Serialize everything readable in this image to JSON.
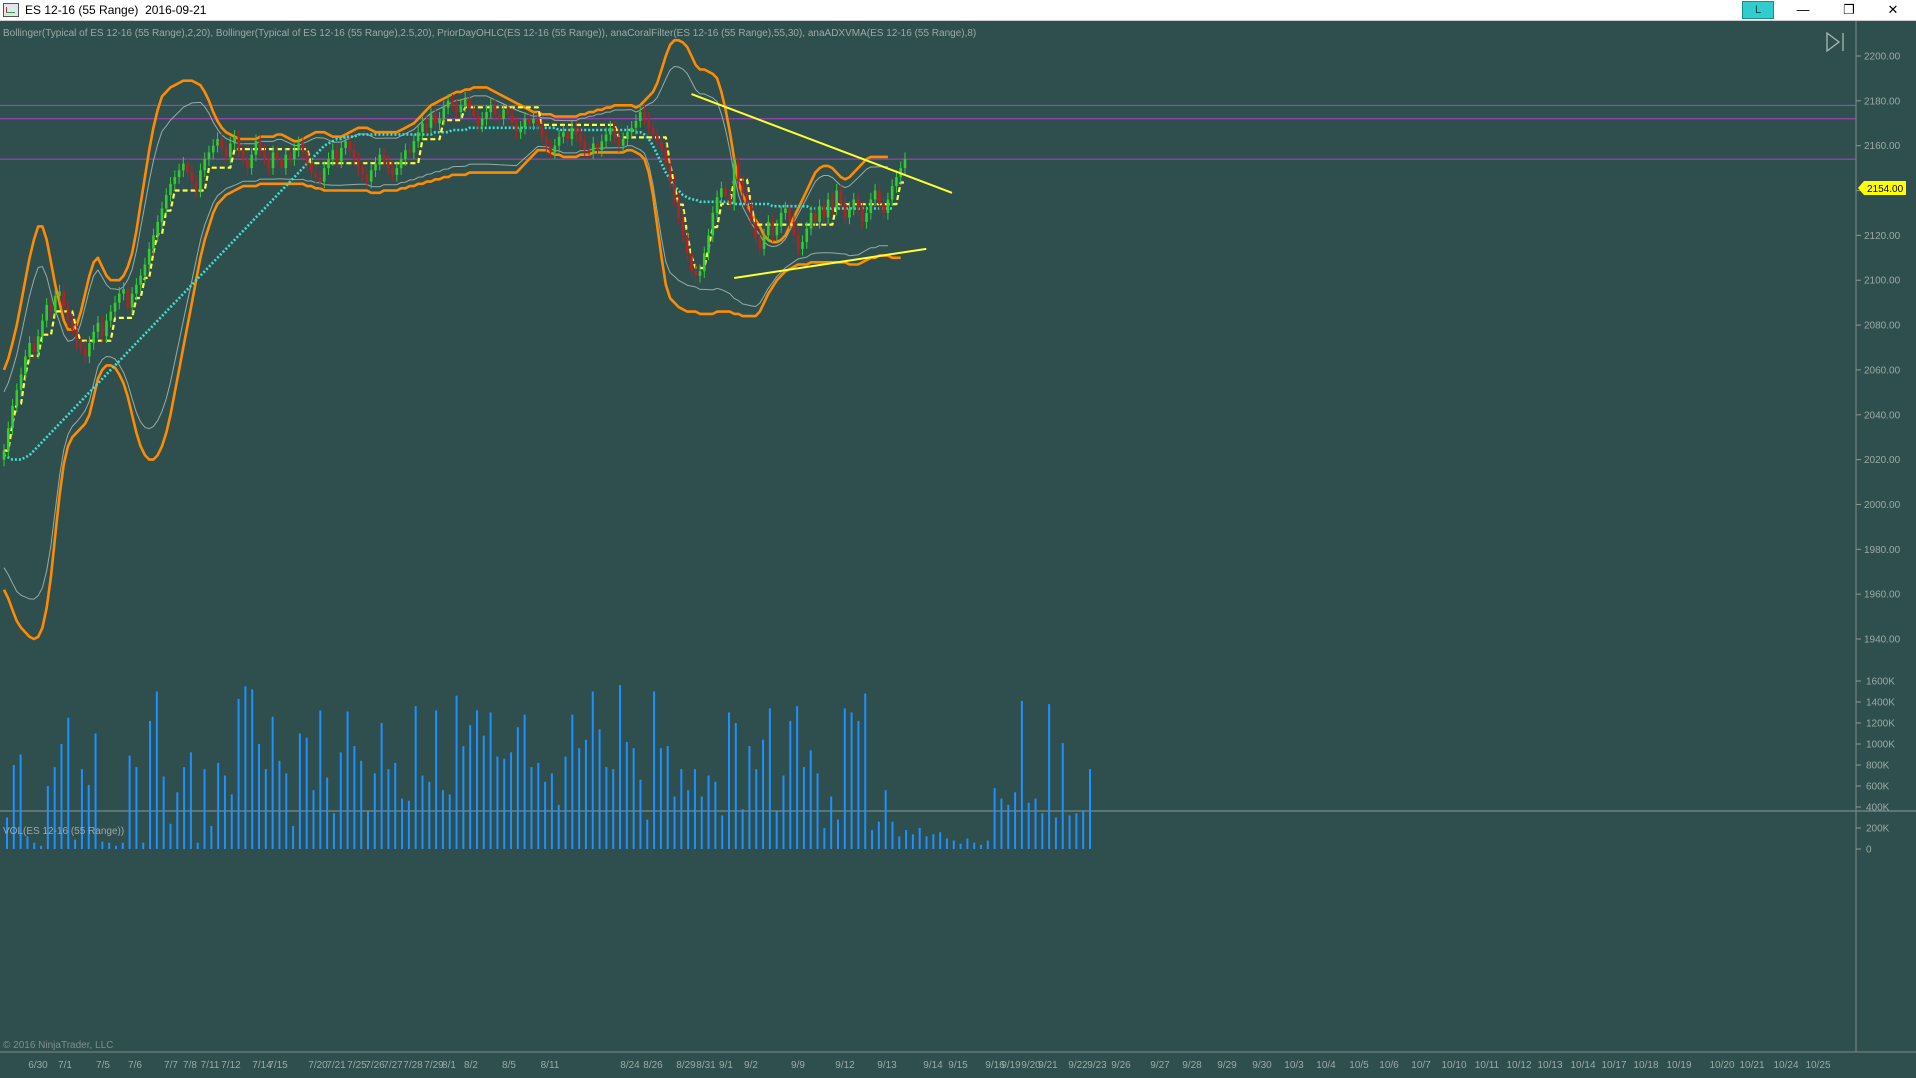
{
  "window": {
    "title": "ES 12-16 (55 Range)  2016-09-21",
    "link_label": "L",
    "minimize_glyph": "—",
    "restore_glyph": "❐",
    "close_glyph": "✕"
  },
  "price_panel": {
    "indicator_label": "Bollinger(Typical of ES 12-16 (55 Range),2,20), Bollinger(Typical of ES 12-16 (55 Range),2.5,20), PriorDayOHLC(ES 12-16 (55 Range)), anaCoralFilter(ES 12-16 (55 Range),55,30), anaADXVMA(ES 12-16 (55 Range),8)",
    "last_price_label": "2154.00"
  },
  "volume_panel": {
    "indicator_label": "VOL(ES 12-16 (55 Range))"
  },
  "copyright": "© 2016 NinjaTrader, LLC",
  "colors": {
    "background": "#2f4f4f",
    "up_candle": "#32cd32",
    "down_candle": "#b22222",
    "bollinger_outer": "#ff8c00",
    "bollinger_inner": "#9aaaa5",
    "coral_filter": "#40e0d0",
    "adxvma": "#ffff40",
    "trendline": "#ffff33",
    "prior_day_lines": "#b040c8",
    "volume": "#1e90ff",
    "last_price_tag": "#ffff00"
  },
  "chart_data": [
    {
      "type": "candlestick",
      "y_ticks": [
        2200,
        2180,
        2160,
        2140,
        2120,
        2100,
        2080,
        2060,
        2040,
        2020,
        2000,
        1980,
        1960,
        1940
      ],
      "ylim": [
        1930,
        2210
      ],
      "x_labels": [
        "6/30",
        "7/1",
        "7/5",
        "7/6",
        "7/7",
        "7/8",
        "7/11",
        "7/12",
        "7/14",
        "7/15",
        "7/20",
        "7/21",
        "7/25",
        "7/26",
        "7/27",
        "7/28",
        "7/29",
        "8/1",
        "8/2",
        "8/5",
        "8/11",
        "8/24",
        "8/26",
        "8/29",
        "8/31",
        "9/1",
        "9/2",
        "9/9",
        "9/12",
        "9/13",
        "9/14",
        "9/15",
        "9/16",
        "9/19",
        "9/20",
        "9/21",
        "9/22",
        "9/23",
        "9/26",
        "9/27",
        "9/28",
        "9/29",
        "9/30",
        "10/3",
        "10/4",
        "10/5",
        "10/6",
        "10/7",
        "10/10",
        "10/11",
        "10/12",
        "10/13",
        "10/14",
        "10/17",
        "10/18",
        "10/19",
        "10/20",
        "10/21",
        "10/24",
        "10/25"
      ],
      "last_price": 2154,
      "prior_day_levels": [
        2178,
        2172,
        2154
      ],
      "trendlines": [
        {
          "from": [
            161,
            2183
          ],
          "to": [
            222,
            2139
          ]
        },
        {
          "from": [
            171,
            2101
          ],
          "to": [
            216,
            2114
          ]
        }
      ],
      "close": [
        2024,
        2034,
        2044,
        2051,
        2058,
        2066,
        2072,
        2068,
        2075,
        2082,
        2089,
        2086,
        2093,
        2095,
        2088,
        2082,
        2078,
        2072,
        2070,
        2066,
        2072,
        2077,
        2081,
        2075,
        2082,
        2086,
        2090,
        2094,
        2096,
        2088,
        2094,
        2098,
        2102,
        2107,
        2114,
        2120,
        2126,
        2132,
        2138,
        2143,
        2146,
        2149,
        2152,
        2148,
        2144,
        2140,
        2149,
        2154,
        2157,
        2160,
        2163,
        2159,
        2155,
        2161,
        2164,
        2158,
        2154,
        2150,
        2156,
        2162,
        2158,
        2154,
        2150,
        2157,
        2154,
        2150,
        2156,
        2154,
        2158,
        2161,
        2157,
        2152,
        2148,
        2146,
        2144,
        2150,
        2154,
        2158,
        2153,
        2159,
        2162,
        2158,
        2154,
        2150,
        2147,
        2144,
        2149,
        2152,
        2156,
        2153,
        2150,
        2147,
        2150,
        2154,
        2158,
        2157,
        2162,
        2166,
        2170,
        2168,
        2174,
        2170,
        2172,
        2177,
        2180,
        2178,
        2175,
        2178,
        2181,
        2176,
        2173,
        2169,
        2172,
        2175,
        2178,
        2174,
        2172,
        2176,
        2174,
        2170,
        2166,
        2168,
        2172,
        2170,
        2172,
        2169,
        2164,
        2160,
        2157,
        2160,
        2164,
        2166,
        2163,
        2168,
        2165,
        2162,
        2158,
        2157,
        2161,
        2158,
        2162,
        2165,
        2168,
        2164,
        2160,
        2163,
        2166,
        2168,
        2171,
        2175,
        2172,
        2168,
        2165,
        2162,
        2158,
        2152,
        2144,
        2136,
        2128,
        2120,
        2112,
        2104,
        2102,
        2104,
        2112,
        2120,
        2130,
        2137,
        2141,
        2138,
        2134,
        2152,
        2144,
        2139,
        2134,
        2126,
        2119,
        2114,
        2120,
        2126,
        2120,
        2124,
        2130,
        2132,
        2126,
        2120,
        2114,
        2117,
        2123,
        2130,
        2126,
        2133,
        2128,
        2136,
        2132,
        2140,
        2134,
        2128,
        2132,
        2136,
        2132,
        2126,
        2130,
        2136,
        2140,
        2134,
        2130,
        2136,
        2142,
        2146,
        2150,
        2154
      ],
      "series": [
        {
          "name": "Bollinger 2.5 upper",
          "values": [
            2060,
            2065,
            2072,
            2080,
            2090,
            2100,
            2110,
            2118,
            2124,
            2124,
            2118,
            2108,
            2098,
            2090,
            2082,
            2078,
            2078,
            2080,
            2086,
            2094,
            2102,
            2108,
            2110,
            2106,
            2102,
            2100,
            2100,
            2100,
            2102,
            2106,
            2112,
            2122,
            2134,
            2146,
            2158,
            2168,
            2176,
            2182,
            2184,
            2186,
            2187,
            2188,
            2189,
            2189,
            2189,
            2188,
            2187,
            2184,
            2180,
            2175,
            2171,
            2168,
            2166,
            2165,
            2164,
            2163,
            2163,
            2163,
            2163,
            2163,
            2164,
            2164,
            2164,
            2164,
            2165,
            2165,
            2164,
            2163,
            2162,
            2162,
            2163,
            2164,
            2165,
            2166,
            2166,
            2166,
            2165,
            2164,
            2164,
            2164,
            2165,
            2166,
            2167,
            2168,
            2168,
            2168,
            2167,
            2166,
            2166,
            2166,
            2166,
            2166,
            2166,
            2167,
            2168,
            2169,
            2170,
            2172,
            2174,
            2176,
            2178,
            2179,
            2180,
            2181,
            2182,
            2183,
            2184,
            2184,
            2185,
            2185,
            2186,
            2186,
            2186,
            2186,
            2185,
            2184,
            2183,
            2182,
            2181,
            2180,
            2179,
            2178,
            2177,
            2176,
            2175,
            2175,
            2174,
            2174,
            2174,
            2173,
            2173,
            2173,
            2173,
            2173,
            2173,
            2174,
            2174,
            2175,
            2175,
            2176,
            2176,
            2177,
            2177,
            2178,
            2178,
            2178,
            2178,
            2178,
            2177,
            2178,
            2180,
            2182,
            2184,
            2188,
            2194,
            2200,
            2205,
            2207,
            2207,
            2206,
            2204,
            2200,
            2196,
            2194,
            2194,
            2193,
            2192,
            2190,
            2184,
            2176,
            2166,
            2154,
            2144,
            2138,
            2134,
            2130,
            2127,
            2124,
            2120,
            2118,
            2117,
            2117,
            2118,
            2120,
            2124,
            2128,
            2132,
            2136,
            2140,
            2144,
            2148,
            2150,
            2151,
            2151,
            2150,
            2148,
            2146,
            2145,
            2146,
            2148,
            2150,
            2152,
            2154,
            2155,
            2155,
            2155,
            2155,
            2155
          ]
        },
        {
          "name": "Bollinger 2.5 lower",
          "values": [
            1962,
            1958,
            1953,
            1948,
            1945,
            1943,
            1941,
            1940,
            1941,
            1945,
            1954,
            1968,
            1986,
            2004,
            2018,
            2026,
            2030,
            2032,
            2034,
            2036,
            2040,
            2048,
            2056,
            2060,
            2062,
            2062,
            2061,
            2058,
            2054,
            2048,
            2040,
            2032,
            2026,
            2022,
            2020,
            2020,
            2022,
            2026,
            2032,
            2040,
            2050,
            2060,
            2070,
            2080,
            2090,
            2100,
            2110,
            2118,
            2124,
            2130,
            2134,
            2136,
            2138,
            2139,
            2140,
            2141,
            2142,
            2142,
            2142,
            2142,
            2143,
            2143,
            2143,
            2143,
            2143,
            2143,
            2143,
            2143,
            2143,
            2143,
            2143,
            2142,
            2142,
            2141,
            2141,
            2140,
            2140,
            2140,
            2140,
            2140,
            2140,
            2140,
            2140,
            2140,
            2140,
            2140,
            2139,
            2139,
            2139,
            2140,
            2140,
            2140,
            2140,
            2141,
            2141,
            2142,
            2142,
            2143,
            2143,
            2144,
            2144,
            2145,
            2145,
            2146,
            2146,
            2147,
            2147,
            2147,
            2147,
            2148,
            2148,
            2148,
            2148,
            2148,
            2148,
            2148,
            2148,
            2148,
            2148,
            2148,
            2148,
            2150,
            2152,
            2154,
            2156,
            2158,
            2158,
            2158,
            2157,
            2156,
            2156,
            2155,
            2155,
            2155,
            2155,
            2156,
            2156,
            2156,
            2157,
            2157,
            2157,
            2157,
            2157,
            2157,
            2157,
            2157,
            2158,
            2158,
            2157,
            2156,
            2154,
            2148,
            2138,
            2124,
            2110,
            2098,
            2092,
            2090,
            2088,
            2087,
            2086,
            2086,
            2086,
            2085,
            2085,
            2085,
            2085,
            2086,
            2086,
            2086,
            2086,
            2085,
            2085,
            2084,
            2084,
            2084,
            2084,
            2086,
            2090,
            2094,
            2097,
            2100,
            2102,
            2104,
            2105,
            2106,
            2107,
            2107,
            2107,
            2108,
            2108,
            2108,
            2108,
            2108,
            2108,
            2108,
            2108,
            2108,
            2107,
            2107,
            2107,
            2108,
            2109,
            2110,
            2110,
            2111,
            2111,
            2111,
            2110,
            2110,
            2110
          ]
        },
        {
          "name": "Coral Filter",
          "values": [
            2022,
            2021,
            2020,
            2020,
            2020,
            2021,
            2022,
            2024,
            2026,
            2028,
            2030,
            2032,
            2034,
            2036,
            2038,
            2040,
            2042,
            2044,
            2046,
            2048,
            2050,
            2052,
            2054,
            2056,
            2058,
            2060,
            2062,
            2064,
            2066,
            2068,
            2070,
            2072,
            2074,
            2076,
            2078,
            2080,
            2082,
            2084,
            2086,
            2088,
            2090,
            2092,
            2094,
            2096,
            2098,
            2100,
            2102,
            2104,
            2106,
            2108,
            2110,
            2112,
            2114,
            2116,
            2118,
            2120,
            2122,
            2124,
            2126,
            2128,
            2130,
            2132,
            2134,
            2136,
            2138,
            2140,
            2142,
            2144,
            2146,
            2148,
            2150,
            2152,
            2154,
            2156,
            2158,
            2160,
            2161,
            2162,
            2163,
            2163,
            2164,
            2164,
            2164,
            2165,
            2165,
            2165,
            2165,
            2165,
            2165,
            2165,
            2165,
            2165,
            2165,
            2165,
            2165,
            2165,
            2165,
            2165,
            2165,
            2165,
            2165,
            2166,
            2166,
            2166,
            2166,
            2167,
            2167,
            2167,
            2167,
            2168,
            2168,
            2168,
            2168,
            2168,
            2168,
            2168,
            2168,
            2168,
            2168,
            2168,
            2168,
            2168,
            2168,
            2168,
            2168,
            2168,
            2168,
            2168,
            2168,
            2168,
            2167,
            2167,
            2167,
            2167,
            2167,
            2167,
            2167,
            2167,
            2167,
            2167,
            2167,
            2167,
            2167,
            2167,
            2167,
            2167,
            2167,
            2167,
            2166,
            2166,
            2165,
            2163,
            2160,
            2156,
            2152,
            2148,
            2145,
            2142,
            2140,
            2138,
            2137,
            2136,
            2136,
            2135,
            2135,
            2135,
            2135,
            2135,
            2135,
            2135,
            2135,
            2134,
            2134,
            2134,
            2134,
            2134,
            2134,
            2134,
            2134,
            2134,
            2133,
            2133,
            2133,
            2133,
            2133,
            2133,
            2133,
            2133,
            2133,
            2132,
            2132,
            2132,
            2132,
            2132,
            2132,
            2132,
            2132,
            2132,
            2132,
            2132,
            2132,
            2132,
            2132,
            2132,
            2132,
            2132,
            2132,
            2132,
            2132
          ]
        }
      ]
    },
    {
      "type": "bar",
      "title": "Volume",
      "y_ticks": [
        "0",
        "200K",
        "400K",
        "600K",
        "800K",
        "1000K",
        "1200K",
        "1400K",
        "1600K"
      ],
      "ylim": [
        0,
        1700
      ],
      "values": [
        300,
        800,
        900,
        120,
        60,
        30,
        600,
        780,
        1000,
        1250,
        90,
        760,
        610,
        1100,
        70,
        60,
        30,
        60,
        890,
        780,
        60,
        1220,
        1500,
        690,
        240,
        540,
        780,
        920,
        60,
        760,
        220,
        820,
        700,
        520,
        1430,
        1550,
        1520,
        1000,
        760,
        1260,
        840,
        720,
        220,
        1100,
        1060,
        560,
        1320,
        680,
        340,
        920,
        1310,
        980,
        840,
        360,
        720,
        1200,
        760,
        820,
        480,
        460,
        1360,
        700,
        640,
        1320,
        560,
        520,
        1460,
        980,
        1180,
        1320,
        1080,
        1300,
        880,
        860,
        920,
        1160,
        1280,
        780,
        820,
        640,
        720,
        420,
        880,
        1280,
        960,
        1040,
        1500,
        1140,
        780,
        760,
        1560,
        1020,
        960,
        660,
        280,
        1500,
        960,
        980,
        500,
        760,
        560,
        760,
        500,
        700,
        640,
        320,
        1300,
        1200,
        380,
        980,
        760,
        1040,
        1340,
        360,
        700,
        1220,
        1360,
        780,
        940,
        720,
        200,
        500,
        280,
        1340,
        1300,
        1220,
        1480,
        180,
        260,
        560,
        260,
        120,
        180,
        140,
        200,
        120,
        140,
        160,
        100,
        80,
        50,
        100,
        60,
        40,
        80,
        580,
        480,
        420,
        540,
        1410,
        440,
        480,
        340,
        1380,
        300,
        1010,
        320,
        340,
        370,
        760
      ]
    }
  ]
}
